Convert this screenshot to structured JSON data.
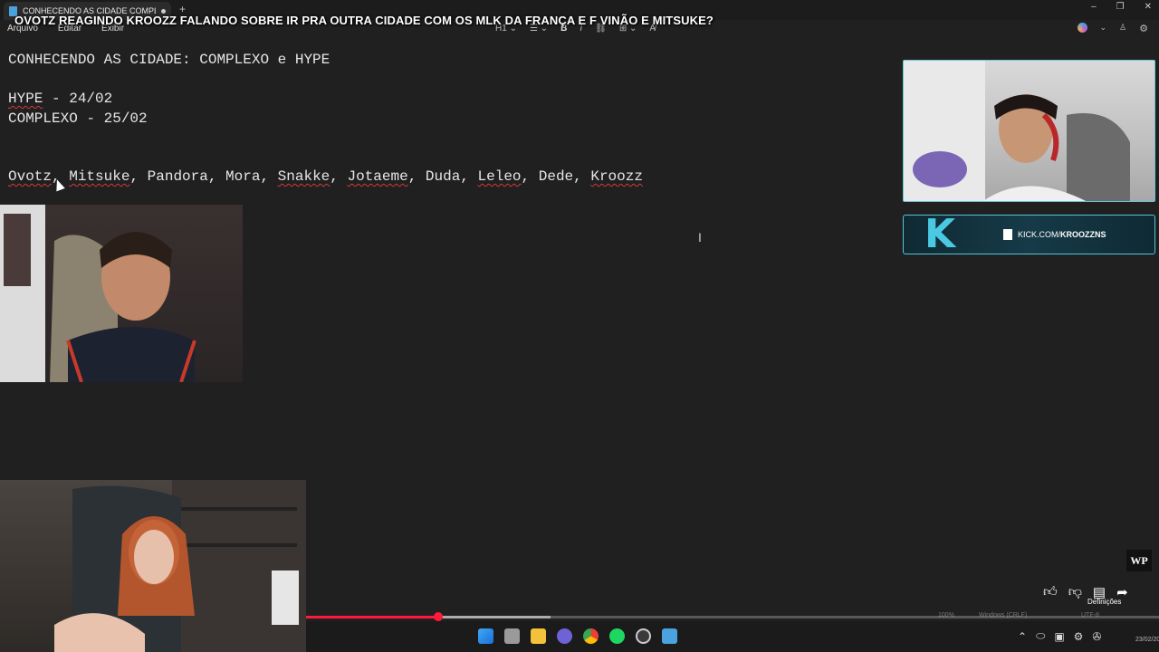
{
  "tab": {
    "title": "CONHECENDO AS CIDADE COMPLI"
  },
  "video_title": "OVOTZ REAGINDO KROOZZ FALANDO SOBRE IR PRA OUTRA CIDADE COM OS MLK DA FRANÇA E F VINÃO E MITSUKE?",
  "menu": {
    "file": "Arquivo",
    "edit": "Editar",
    "view": "Exibir"
  },
  "format": {
    "heading": "H1",
    "bold": "B",
    "italic": "I"
  },
  "document": {
    "line1": "CONHECENDO AS CIDADE: COMPLEXO e HYPE",
    "line2_word": "HYPE",
    "line2_rest": " - 24/02",
    "line3": "COMPLEXO - 25/02",
    "names_line": [
      "Ovotz",
      ", ",
      "Mitsuke",
      ", Pandora, Mora, ",
      "Snakke",
      ", ",
      "Jotaeme",
      ", Duda, ",
      "Leleo",
      ", Dede, ",
      "Kroozz"
    ]
  },
  "kick": {
    "domain": "KICK.COM/",
    "channel": "KROOZZNS"
  },
  "watermark": "WP",
  "youtube": {
    "settings_label": "Definições",
    "progress_fraction": 0.155
  },
  "statusbar": {
    "zoom": "100%",
    "line_ending": "Windows (CRLF)",
    "encoding": "UTF-8"
  },
  "clock": {
    "time": "23",
    "date": "23/02/2026"
  },
  "colors": {
    "accent_cyan": "#4cc9e2",
    "progress_red": "#ff1a3c",
    "squiggle": "#d03b3b"
  }
}
